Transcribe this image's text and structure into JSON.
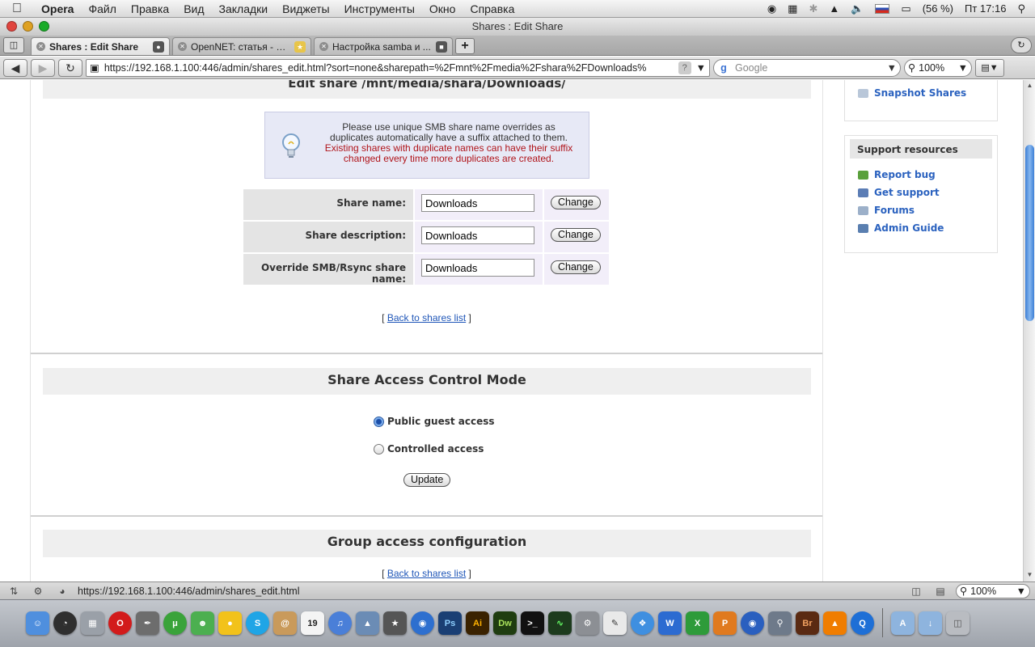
{
  "menubar": {
    "app": "Opera",
    "items": [
      "Файл",
      "Правка",
      "Вид",
      "Закладки",
      "Виджеты",
      "Инструменты",
      "Окно",
      "Справка"
    ],
    "battery": "(56 %)",
    "clock": "Пт 17:16"
  },
  "window": {
    "title": "Shares : Edit Share"
  },
  "tabs": [
    {
      "label": "Shares : Edit Share",
      "active": true
    },
    {
      "label": "OpenNET: статья - О...",
      "active": false
    },
    {
      "label": "Настройка samba и ...",
      "active": false
    }
  ],
  "navbar": {
    "url": "https://192.168.1.100:446/admin/shares_edit.html?sort=none&sharepath=%2Fmnt%2Fmedia%2Fshara%2FDownloads%",
    "search_placeholder": "Google",
    "zoom": "100%"
  },
  "page": {
    "edit_title": "Edit share /mnt/media/shara/Downloads/",
    "notice_line1": "Please use unique SMB share name overrides as",
    "notice_line2": "duplicates automatically have a suffix attached to them.",
    "notice_warn1": "Existing shares with duplicate names can have their suffix",
    "notice_warn2": "changed every time more duplicates are created.",
    "form": [
      {
        "label": "Share name:",
        "value": "Downloads",
        "button": "Change"
      },
      {
        "label": "Share description:",
        "value": "Downloads",
        "button": "Change"
      },
      {
        "label": "Override SMB/Rsync share name:",
        "value": "Downloads",
        "button": "Change"
      }
    ],
    "back_link": "Back to shares list",
    "access_title": "Share Access Control Mode",
    "radio_public": "Public guest access",
    "radio_controlled": "Controlled access",
    "update_button": "Update",
    "group_title": "Group access configuration"
  },
  "sidebar": {
    "snapshot_link": "Snapshot Shares",
    "support_title": "Support resources",
    "links": [
      "Report bug",
      "Get support",
      "Forums",
      "Admin Guide"
    ]
  },
  "statusbar": {
    "url": "https://192.168.1.100:446/admin/shares_edit.html",
    "zoom": "100%"
  },
  "dock": {
    "icons": [
      "finder-icon",
      "dashboard-icon",
      "calculator-icon",
      "opera-icon",
      "script-icon",
      "utorrent-icon",
      "adium-icon",
      "cyberduck-icon",
      "skype-icon",
      "addressbook-icon",
      "ical-icon",
      "itunes-icon",
      "iphoto-icon",
      "imovie-icon",
      "dvd-icon",
      "photoshop-icon",
      "illustrator-icon",
      "dreamweaver-icon",
      "terminal-icon",
      "activity-monitor-icon",
      "system-preferences-icon",
      "textedit-icon",
      "safari-icon",
      "word-icon",
      "excel-icon",
      "powerpoint-icon",
      "google-earth-icon",
      "preview-icon",
      "bridge-icon",
      "vlc-icon",
      "quicktime-icon",
      "applications-icon",
      "downloads-icon",
      "trash-icon"
    ],
    "calendar_day": "19"
  }
}
